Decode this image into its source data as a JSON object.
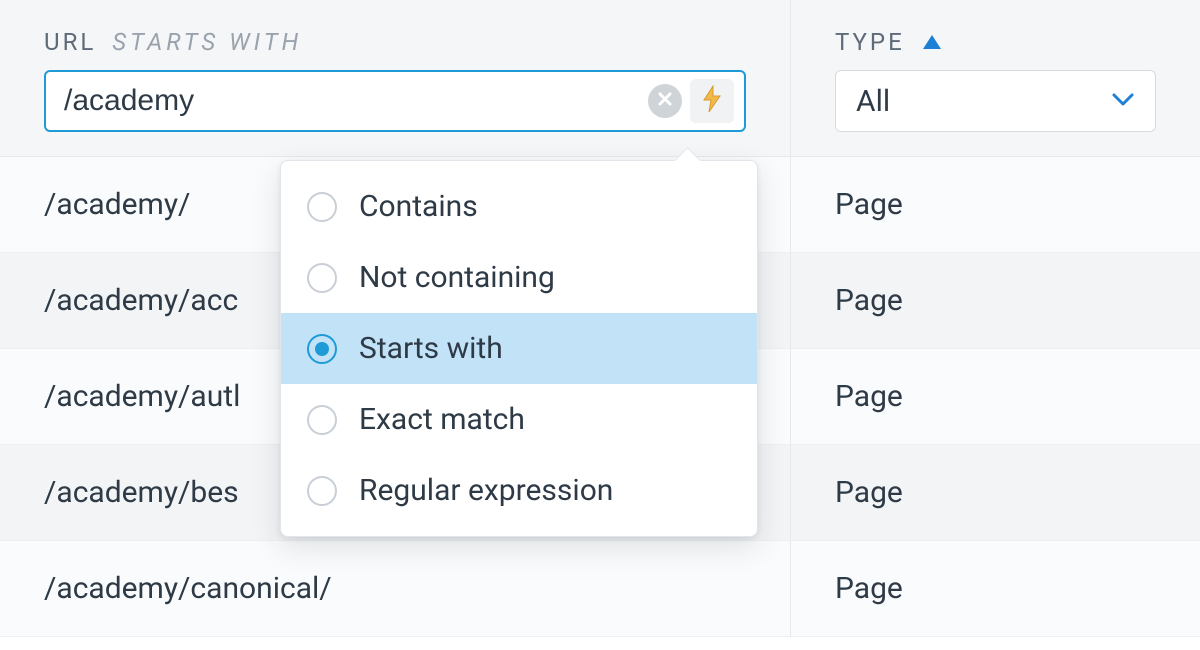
{
  "columns": {
    "url": {
      "label": "URL",
      "mode": "STARTS WITH"
    },
    "type": {
      "label": "TYPE"
    }
  },
  "url_filter": {
    "value": "/academy"
  },
  "type_filter": {
    "value": "All"
  },
  "popover": {
    "options": [
      {
        "label": "Contains"
      },
      {
        "label": "Not containing"
      },
      {
        "label": "Starts with",
        "selected": true
      },
      {
        "label": "Exact match"
      },
      {
        "label": "Regular expression"
      }
    ]
  },
  "rows": [
    {
      "url": "/academy/",
      "type": "Page"
    },
    {
      "url": "/academy/acc",
      "type": "Page"
    },
    {
      "url": "/academy/autl",
      "type": "Page"
    },
    {
      "url": "/academy/bes",
      "type": "Page"
    },
    {
      "url": "/academy/canonical/",
      "type": "Page"
    }
  ]
}
